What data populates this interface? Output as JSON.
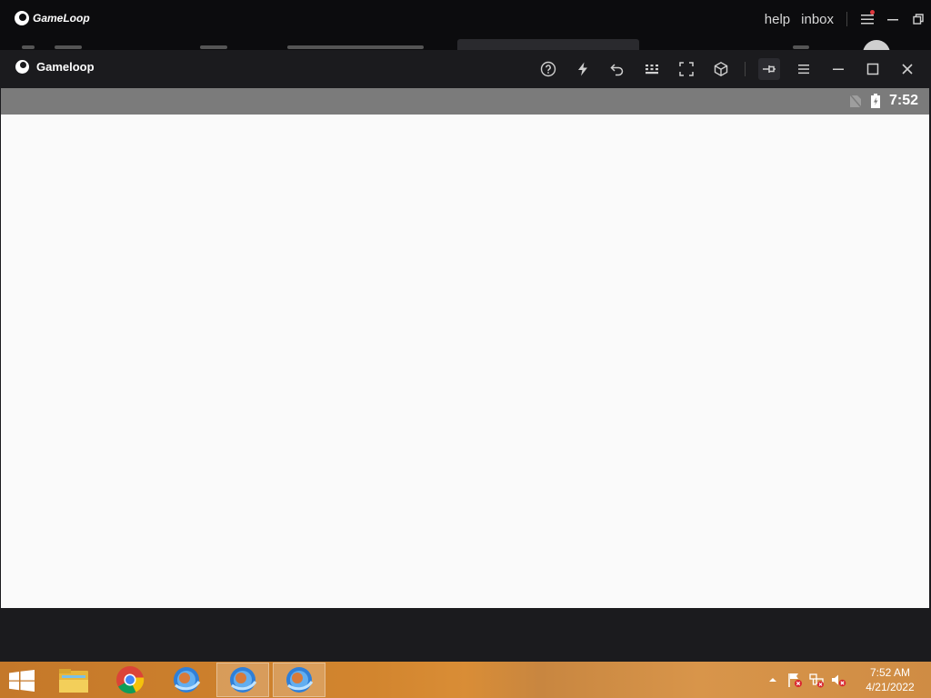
{
  "background_app": {
    "logo_text": "GameLoop",
    "links": [
      "help",
      "inbox"
    ]
  },
  "window": {
    "title": "Gameloop",
    "toolbar": [
      {
        "name": "help-icon"
      },
      {
        "name": "boost-icon"
      },
      {
        "name": "undo-icon"
      },
      {
        "name": "keymap-icon"
      },
      {
        "name": "fullscreen-icon"
      },
      {
        "name": "3d-cube-icon"
      },
      {
        "name": "pin-icon"
      },
      {
        "name": "menu-icon"
      },
      {
        "name": "minimize-icon"
      },
      {
        "name": "maximize-icon"
      },
      {
        "name": "close-icon"
      }
    ]
  },
  "android_status": {
    "time": "7:52",
    "icons": [
      "no-sim-icon",
      "battery-charging-icon"
    ]
  },
  "taskbar": {
    "apps": [
      {
        "name": "file-explorer-icon",
        "active": false
      },
      {
        "name": "chrome-icon",
        "active": false
      },
      {
        "name": "gameloop-icon",
        "active": false
      },
      {
        "name": "gameloop-icon",
        "active": true
      },
      {
        "name": "gameloop-icon",
        "active": true
      }
    ],
    "tray_icons": [
      "show-hidden-icons-arrow",
      "action-center-flag-icon",
      "network-icon",
      "volume-muted-icon"
    ],
    "clock_time": "7:52 AM",
    "clock_date": "4/21/2022"
  }
}
